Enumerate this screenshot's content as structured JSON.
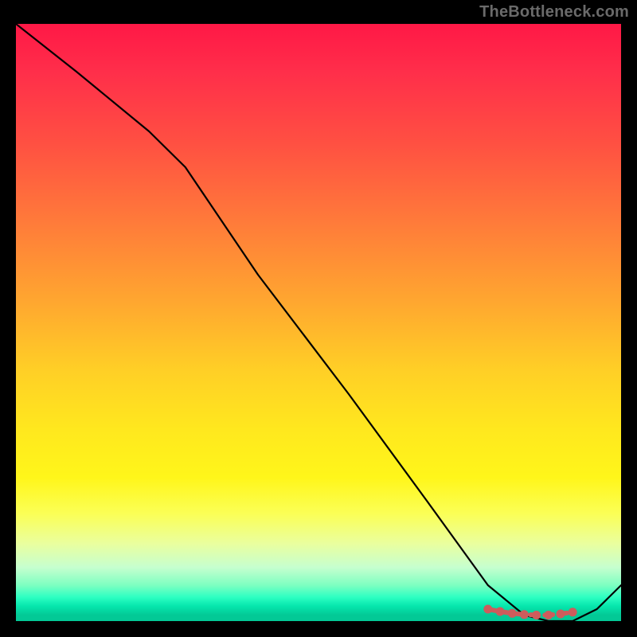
{
  "watermark": "TheBottleneck.com",
  "chart_data": {
    "type": "line",
    "title": "",
    "xlabel": "",
    "ylabel": "",
    "x_range": [
      0,
      100
    ],
    "y_range": [
      0,
      100
    ],
    "series": [
      {
        "name": "curve",
        "x": [
          0,
          10,
          22,
          28,
          40,
          55,
          68,
          78,
          84,
          88,
          92,
          96,
          100
        ],
        "y": [
          100,
          92,
          82,
          76,
          58,
          38,
          20,
          6,
          1,
          0,
          0,
          2,
          6
        ]
      }
    ],
    "marker_cluster": {
      "name": "optimal-zone",
      "x": [
        78,
        80,
        82,
        84,
        86,
        88,
        90,
        92
      ],
      "y": [
        2.0,
        1.6,
        1.3,
        1.1,
        1.0,
        1.0,
        1.2,
        1.5
      ]
    },
    "background": {
      "type": "vertical-gradient",
      "stops": [
        {
          "pos": 0.0,
          "color": "#ff1846"
        },
        {
          "pos": 0.33,
          "color": "#ff7a3a"
        },
        {
          "pos": 0.58,
          "color": "#ffcf26"
        },
        {
          "pos": 0.82,
          "color": "#fbff56"
        },
        {
          "pos": 0.94,
          "color": "#7dffc1"
        },
        {
          "pos": 1.0,
          "color": "#03c996"
        }
      ]
    }
  }
}
